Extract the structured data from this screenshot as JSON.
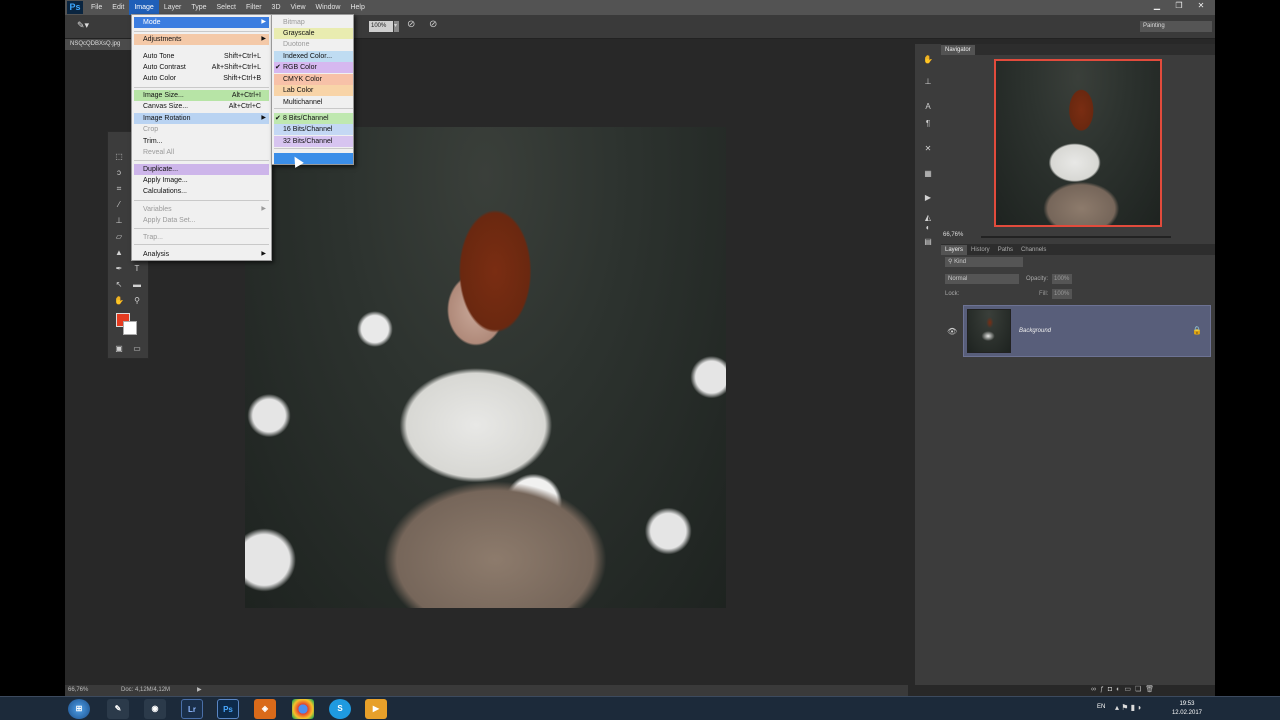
{
  "menubar": {
    "logo": "Ps",
    "items": [
      "File",
      "Edit",
      "Image",
      "Layer",
      "Type",
      "Select",
      "Filter",
      "3D",
      "View",
      "Window",
      "Help"
    ],
    "active": "Image"
  },
  "window_controls": {
    "minimize": "▁",
    "restore": "❐",
    "close": "✕"
  },
  "options_bar": {
    "zoom_value": "100%",
    "workspace": "Painting"
  },
  "document": {
    "tab_name": "NSQcQDBXsQ.jpg",
    "status_zoom": "66,76%",
    "status_doc": "Doc: 4,12M/4,12M"
  },
  "image_menu": {
    "items": [
      {
        "label": "Mode",
        "shortcut": "",
        "submenu": true,
        "highlight": "#3b7de0",
        "text_color": "#ffffff",
        "disabled": false
      },
      {
        "label": "Adjustments",
        "shortcut": "",
        "submenu": true,
        "highlight": "#f4c9a8",
        "text_color": "#111111",
        "disabled": false
      },
      {
        "label": "Auto Tone",
        "shortcut": "Shift+Ctrl+L",
        "submenu": false,
        "highlight": "",
        "disabled": false
      },
      {
        "label": "Auto Contrast",
        "shortcut": "Alt+Shift+Ctrl+L",
        "submenu": false,
        "highlight": "",
        "disabled": false
      },
      {
        "label": "Auto Color",
        "shortcut": "Shift+Ctrl+B",
        "submenu": false,
        "highlight": "",
        "disabled": false
      },
      {
        "label": "Image Size...",
        "shortcut": "Alt+Ctrl+I",
        "submenu": false,
        "highlight": "#b7e4a6",
        "disabled": false
      },
      {
        "label": "Canvas Size...",
        "shortcut": "Alt+Ctrl+C",
        "submenu": false,
        "highlight": "",
        "disabled": false
      },
      {
        "label": "Image Rotation",
        "shortcut": "",
        "submenu": true,
        "highlight": "#b9d3f2",
        "disabled": false
      },
      {
        "label": "Crop",
        "shortcut": "",
        "submenu": false,
        "highlight": "",
        "disabled": true
      },
      {
        "label": "Trim...",
        "shortcut": "",
        "submenu": false,
        "highlight": "",
        "disabled": false
      },
      {
        "label": "Reveal All",
        "shortcut": "",
        "submenu": false,
        "highlight": "",
        "disabled": true
      },
      {
        "label": "Duplicate...",
        "shortcut": "",
        "submenu": false,
        "highlight": "#cdb5ea",
        "disabled": false
      },
      {
        "label": "Apply Image...",
        "shortcut": "",
        "submenu": false,
        "highlight": "",
        "disabled": false
      },
      {
        "label": "Calculations...",
        "shortcut": "",
        "submenu": false,
        "highlight": "",
        "disabled": false
      },
      {
        "label": "Variables",
        "shortcut": "",
        "submenu": true,
        "highlight": "",
        "disabled": true
      },
      {
        "label": "Apply Data Set...",
        "shortcut": "",
        "submenu": false,
        "highlight": "",
        "disabled": true
      },
      {
        "label": "Trap...",
        "shortcut": "",
        "submenu": false,
        "highlight": "",
        "disabled": true
      },
      {
        "label": "Analysis",
        "shortcut": "",
        "submenu": true,
        "highlight": "",
        "disabled": false
      }
    ]
  },
  "mode_submenu": {
    "items": [
      {
        "label": "Bitmap",
        "checked": false,
        "highlight": "",
        "disabled": true
      },
      {
        "label": "Grayscale",
        "checked": false,
        "highlight": "#e9ecb0",
        "disabled": false
      },
      {
        "label": "Duotone",
        "checked": false,
        "highlight": "",
        "disabled": true
      },
      {
        "label": "Indexed Color...",
        "checked": false,
        "highlight": "#bfdcf2",
        "disabled": false
      },
      {
        "label": "RGB Color",
        "checked": true,
        "highlight": "#d6b8f0",
        "disabled": false
      },
      {
        "label": "CMYK Color",
        "checked": false,
        "highlight": "#f7c1a8",
        "disabled": false
      },
      {
        "label": "Lab Color",
        "checked": false,
        "highlight": "#f8d4a8",
        "disabled": false
      },
      {
        "label": "Multichannel",
        "checked": false,
        "highlight": "",
        "disabled": false
      },
      {
        "label": "8 Bits/Channel",
        "checked": true,
        "highlight": "#bfe8b0",
        "disabled": false
      },
      {
        "label": "16 Bits/Channel",
        "checked": false,
        "highlight": "#c4d8f4",
        "disabled": false
      },
      {
        "label": "32 Bits/Channel",
        "checked": false,
        "highlight": "#d7c4f0",
        "disabled": false
      },
      {
        "label": "",
        "checked": false,
        "highlight": "#3b8ee8",
        "disabled": false
      }
    ]
  },
  "navigator": {
    "title": "Navigator",
    "zoom": "66,76%"
  },
  "layers_panel": {
    "tabs": [
      "Layers",
      "History",
      "Paths",
      "Channels"
    ],
    "kind": "Kind",
    "blend_mode": "Normal",
    "opacity_label": "Opacity:",
    "opacity_value": "100%",
    "lock_label": "Lock:",
    "fill_label": "Fill:",
    "fill_value": "100%",
    "layer_name": "Background"
  },
  "taskbar": {
    "apps": [
      "start",
      "app-pencil",
      "app-obs",
      "Lr",
      "Ps",
      "app-vpn",
      "app-chrome",
      "S",
      "app-video"
    ],
    "lang": "EN",
    "time": "19:53",
    "date": "12.02.2017"
  },
  "colors": {
    "accent": "#1f5fb8",
    "foreground_swatch": "#e53b20",
    "background_swatch": "#ffffff",
    "layer_selected": "#585e7a"
  }
}
